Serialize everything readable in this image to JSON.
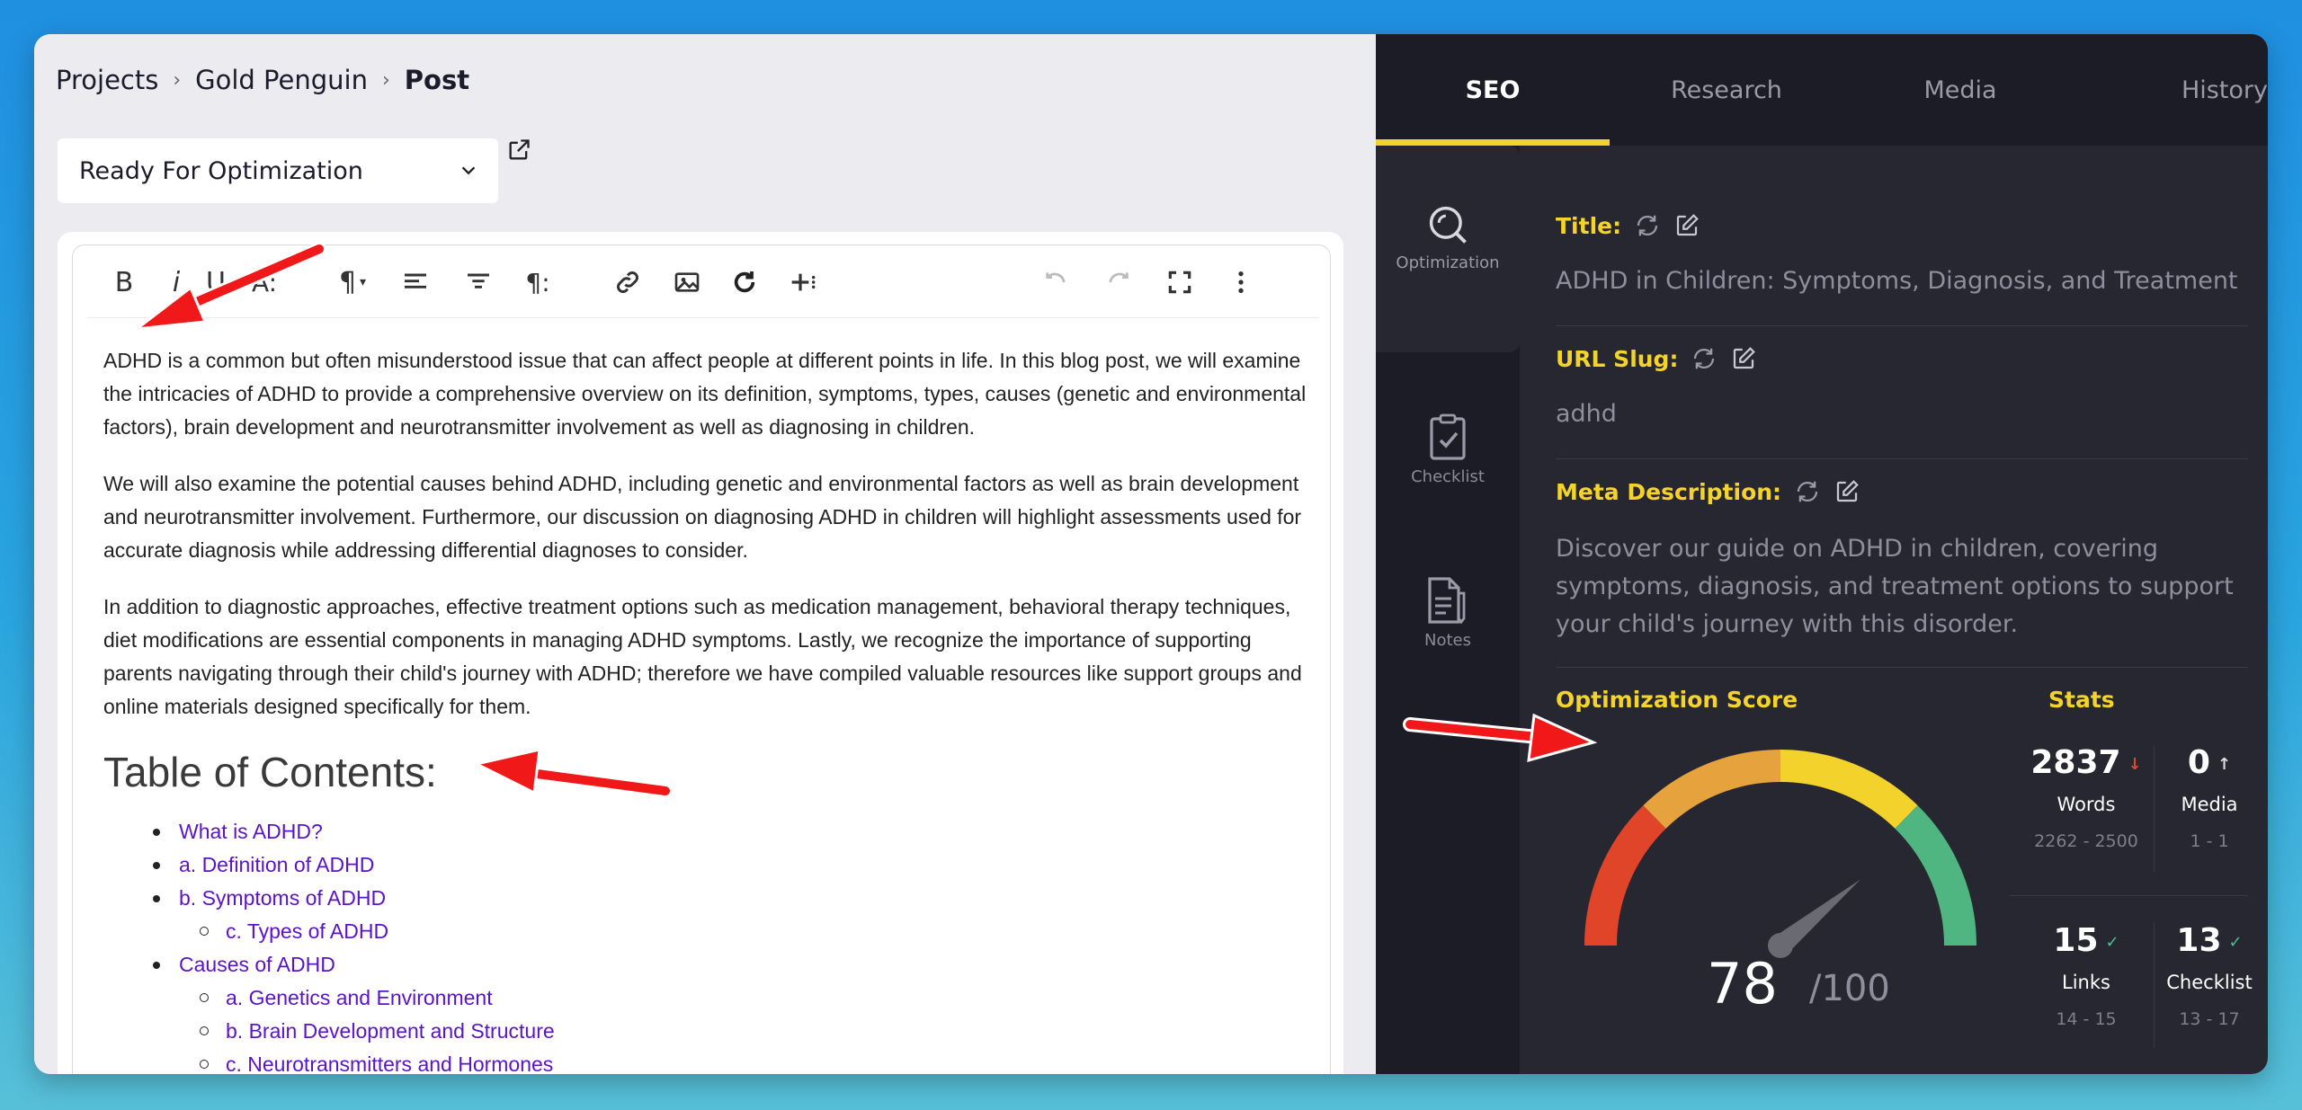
{
  "breadcrumb": {
    "items": [
      "Projects",
      "Gold Penguin"
    ],
    "current": "Post"
  },
  "status_select": {
    "value": "Ready For Optimization"
  },
  "editor": {
    "toolbar": {
      "bold": "B",
      "italic": "i",
      "underline": "U",
      "font_size": "A:",
      "paragraph": "¶",
      "paragraph_format": "¶:"
    },
    "paragraphs": [
      "ADHD is a common but often misunderstood issue that can affect people at different points in life. In this blog post, we will examine the intricacies of ADHD to provide a comprehensive overview on its definition, symptoms, types, causes (genetic and environmental factors), brain development and neurotransmitter involvement as well as diagnosing in children.",
      "We will also examine the potential causes behind ADHD, including genetic and environmental factors as well as brain development and neurotransmitter involvement. Furthermore, our discussion on diagnosing ADHD in children will highlight assessments used for accurate diagnosis while addressing differential diagnoses to consider.",
      "In addition to diagnostic approaches, effective treatment options such as medication management, behavioral therapy techniques, diet modifications are essential components in managing ADHD symptoms. Lastly, we recognize the importance of supporting parents navigating through their child's journey with ADHD; therefore we have compiled valuable resources like support groups and online materials designed specifically for them."
    ],
    "toc_title": "Table of Contents:",
    "toc": [
      {
        "label": "What is ADHD?",
        "level": 1
      },
      {
        "label": "a. Definition of ADHD",
        "level": 1
      },
      {
        "label": "b. Symptoms of ADHD",
        "level": 1
      },
      {
        "label": "c. Types of ADHD",
        "level": 2
      },
      {
        "label": "Causes of ADHD",
        "level": 1
      },
      {
        "label": "a. Genetics and Environment",
        "level": 2
      },
      {
        "label": "b. Brain Development and Structure",
        "level": 2
      },
      {
        "label": "c. Neurotransmitters and Hormones",
        "level": 2
      }
    ]
  },
  "tabs": [
    "SEO",
    "Research",
    "Media",
    "History"
  ],
  "rail": {
    "optimization": "Optimization",
    "checklist": "Checklist",
    "notes": "Notes"
  },
  "seo": {
    "title_label": "Title:",
    "title_value": "ADHD in Children: Symptoms, Diagnosis, and Treatment",
    "slug_label": "URL Slug:",
    "slug_value": "adhd",
    "meta_label": "Meta Description:",
    "meta_value": "Discover our guide on ADHD in children, covering symptoms, diagnosis, and treatment options to support your child's journey with this disorder.",
    "score_label": "Optimization Score",
    "score": "78",
    "score_max": "/100",
    "score_value": 78,
    "stats_label": "Stats",
    "stats": [
      {
        "value": "2837",
        "indicator": "↓",
        "name": "Words",
        "range": "2262 - 2500"
      },
      {
        "value": "0",
        "indicator": "↑",
        "name": "Media",
        "range": "1 - 1"
      },
      {
        "value": "15",
        "indicator": "✓",
        "name": "Links",
        "range": "14 - 15"
      },
      {
        "value": "13",
        "indicator": "✓",
        "name": "Checklist",
        "range": "13 - 17"
      }
    ]
  },
  "colors": {
    "accent": "#f5d32a",
    "link": "#5a14c8",
    "arrow": "#f01818",
    "down": "#e0453a",
    "check": "#4fc08d"
  }
}
